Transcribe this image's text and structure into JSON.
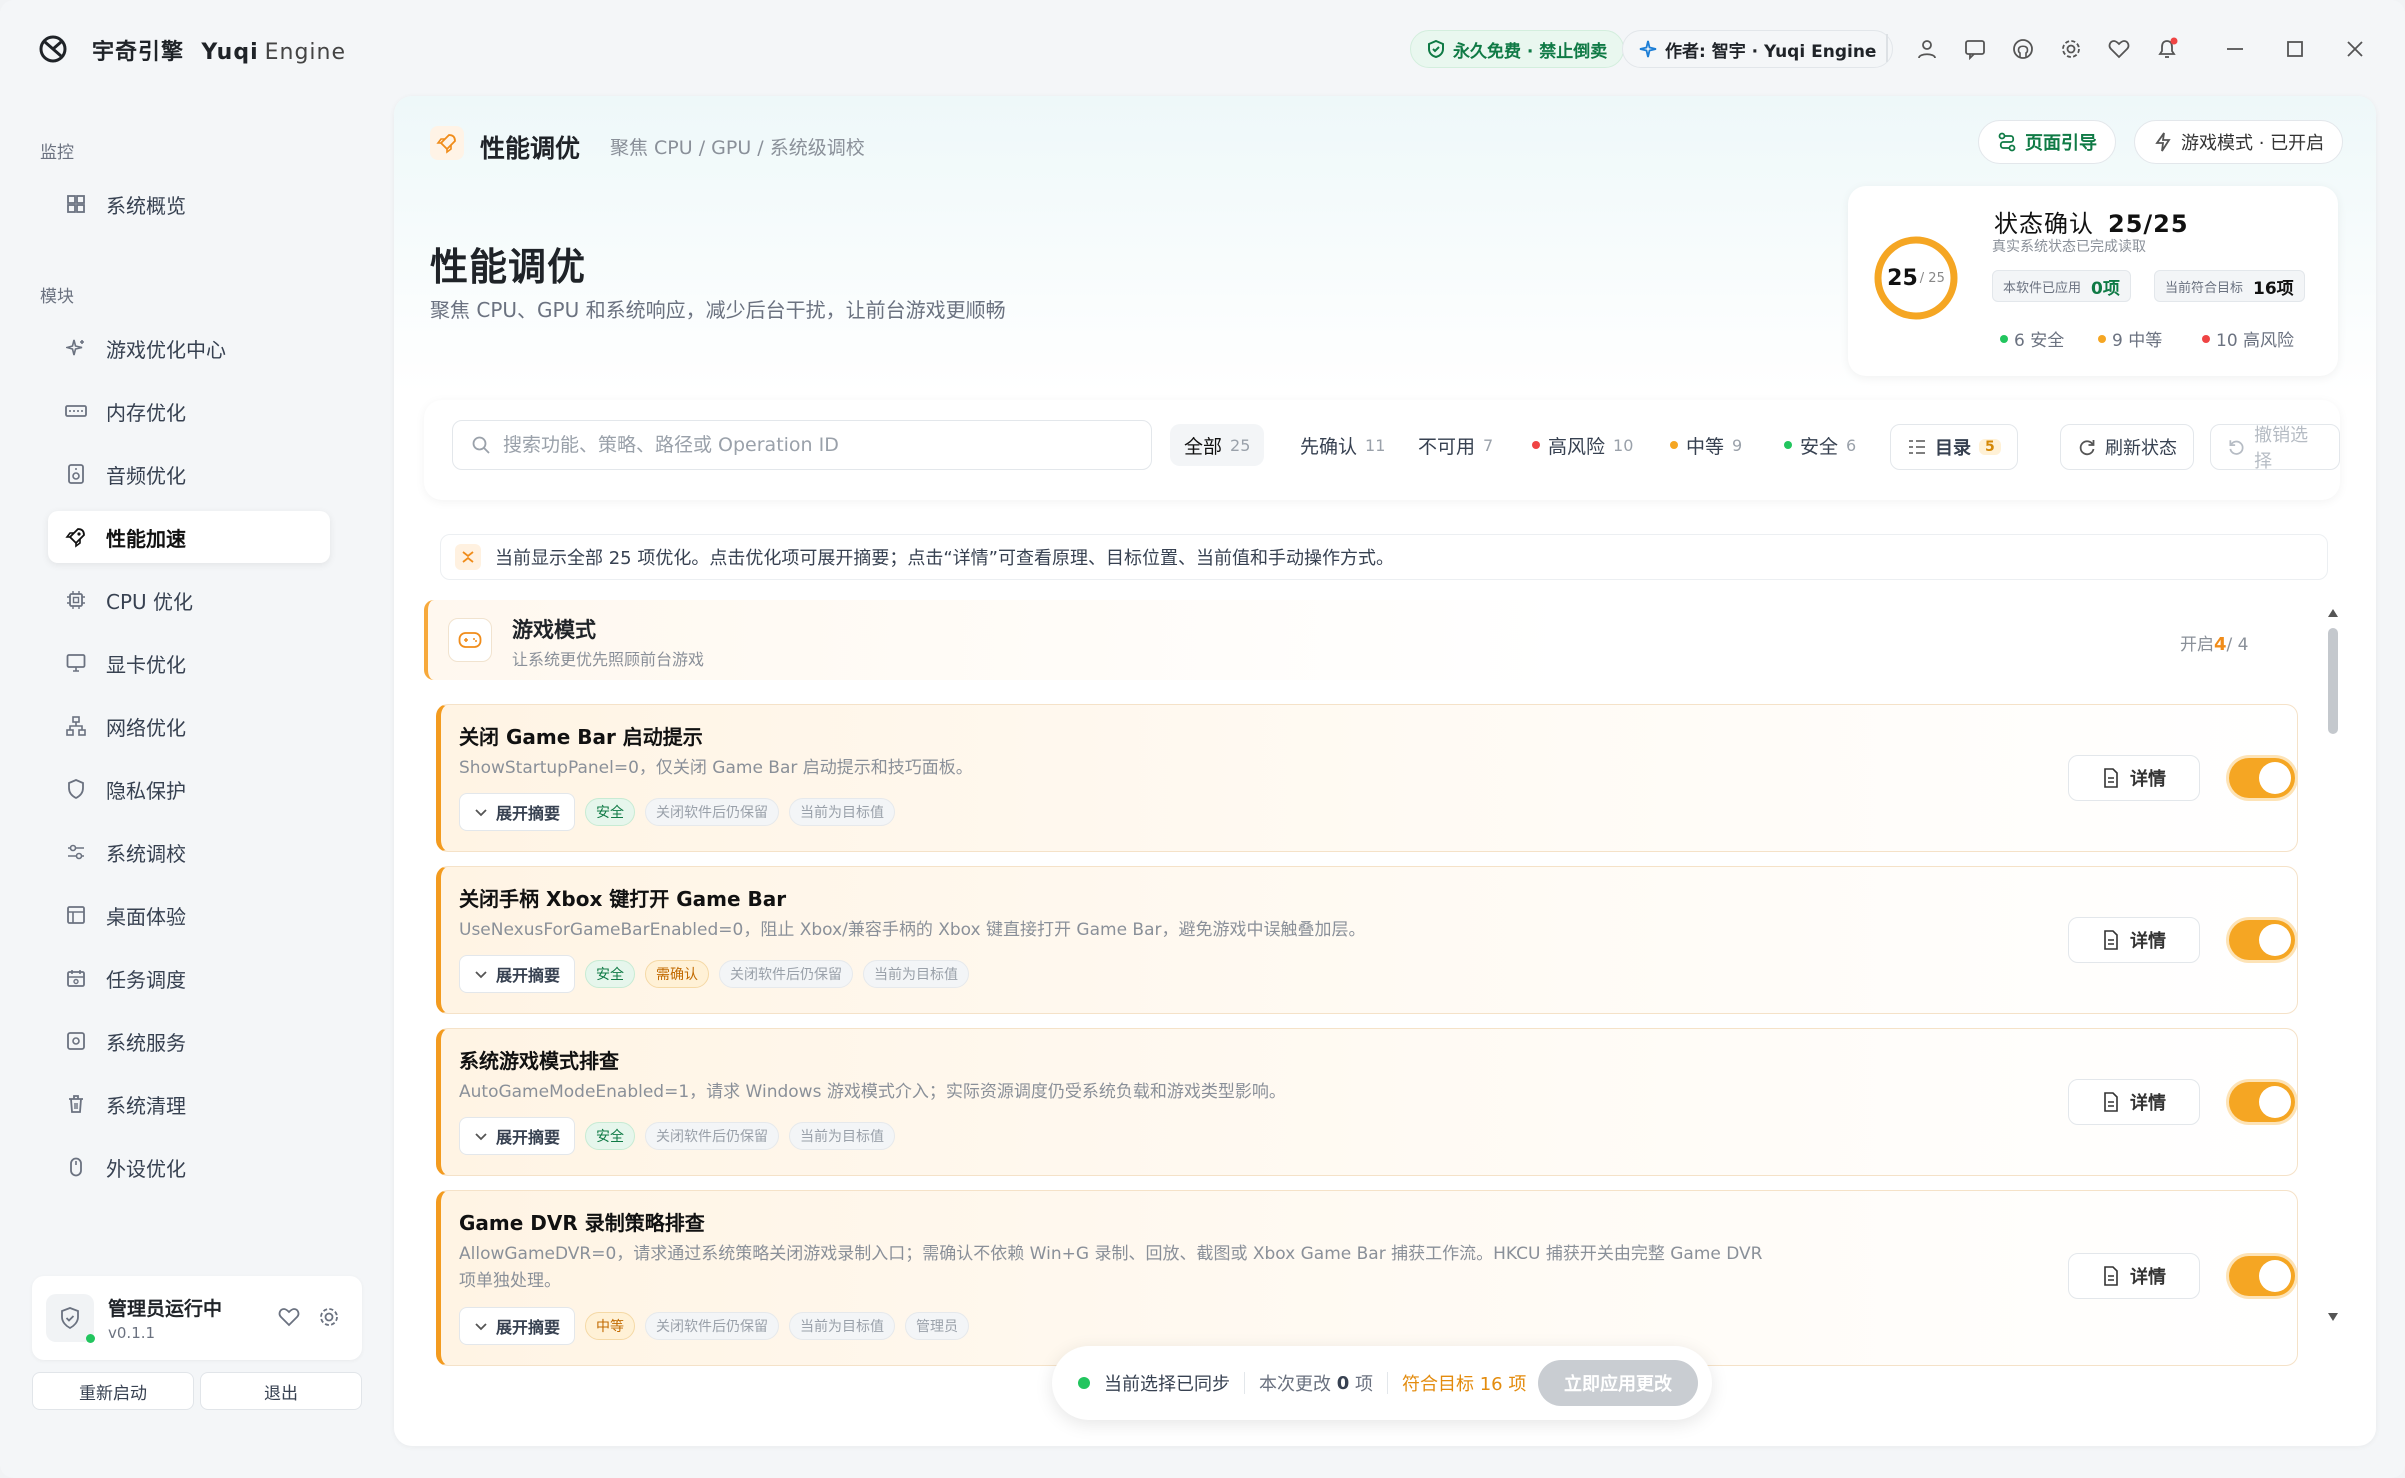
{
  "app": {
    "name": "宇奇引擎",
    "name_en": "Yuqi",
    "name_sub": "Engine"
  },
  "titlebar": {
    "free_label": "永久免费 · 禁止倒卖",
    "author_label": "作者: 智宇 · Yuqi Engine",
    "icons": [
      "user-icon",
      "message-icon",
      "github-icon",
      "gear-icon",
      "heart-icon",
      "bell-icon",
      "minimize-icon",
      "maximize-icon",
      "close-icon"
    ]
  },
  "sidebar": {
    "section_monitor": "监控",
    "section_modules": "模块",
    "overview": "系统概览",
    "items": [
      {
        "label": "游戏优化中心",
        "icon": "sparkle-icon"
      },
      {
        "label": "内存优化",
        "icon": "memory-icon"
      },
      {
        "label": "音频优化",
        "icon": "speaker-icon"
      },
      {
        "label": "性能加速",
        "icon": "rocket-icon",
        "active": true
      },
      {
        "label": "CPU 优化",
        "icon": "cpu-icon"
      },
      {
        "label": "显卡优化",
        "icon": "monitor-icon"
      },
      {
        "label": "网络优化",
        "icon": "network-icon"
      },
      {
        "label": "隐私保护",
        "icon": "shield-icon"
      },
      {
        "label": "系统调校",
        "icon": "sliders-icon"
      },
      {
        "label": "桌面体验",
        "icon": "layout-icon"
      },
      {
        "label": "任务调度",
        "icon": "calendar-icon"
      },
      {
        "label": "系统服务",
        "icon": "service-icon"
      },
      {
        "label": "系统清理",
        "icon": "trash-icon"
      },
      {
        "label": "外设优化",
        "icon": "mouse-icon"
      }
    ],
    "admin": {
      "title": "管理员运行中",
      "version": "v0.1.1"
    },
    "restart_label": "重新启动",
    "exit_label": "退出"
  },
  "header": {
    "title": "性能调优",
    "subtitle": "聚焦 CPU / GPU / 系统级调校",
    "guide_label": "页面引导",
    "game_mode_label": "游戏模式 · 已开启",
    "h1": "性能调优",
    "h1_sub": "聚焦 CPU、GPU 和系统响应，减少后台干扰，让前台游戏更顺畅"
  },
  "status": {
    "ring_value": "25",
    "ring_total": "/ 25",
    "ring_fraction": 1.0,
    "title": "状态确认",
    "title_value": "25/25",
    "sub": "真实系统状态已完成读取",
    "applied_label": "本软件已应用",
    "applied_value": "0项",
    "match_label": "当前符合目标",
    "match_value": "16项",
    "safe": "6 安全",
    "mid": "9 中等",
    "high": "10 高风险",
    "colors": {
      "safe": "#22c55e",
      "mid": "#f5a623",
      "high": "#ef4444"
    }
  },
  "filters": {
    "search_placeholder": "搜索功能、策略、路径或 Operation ID",
    "tabs": [
      {
        "label": "全部",
        "count": "25"
      },
      {
        "label": "先确认",
        "count": "11"
      },
      {
        "label": "不可用",
        "count": "7"
      },
      {
        "label": "高风险",
        "count": "10"
      },
      {
        "label": "中等",
        "count": "9"
      },
      {
        "label": "安全",
        "count": "6"
      }
    ],
    "toc_label": "目录",
    "toc_count": "5",
    "refresh_label": "刷新状态",
    "undo_label": "撤销选择"
  },
  "info": "当前显示全部 25 项优化。点击优化项可展开摘要；点击“详情”可查看原理、目标位置、当前值和手动操作方式。",
  "group": {
    "title": "游戏模式",
    "subtitle": "让系统更优先照顾前台游戏",
    "count_prefix": "开启",
    "count_on": "4",
    "count_total": "/ 4"
  },
  "items": [
    {
      "title": "关闭 Game Bar 启动提示",
      "desc": "ShowStartupPanel=0，仅关闭 Game Bar 启动提示和技巧面板。",
      "tags": [
        "安全",
        "关闭软件后仍保留",
        "当前为目标值"
      ]
    },
    {
      "title": "关闭手柄 Xbox 键打开 Game Bar",
      "desc": "UseNexusForGameBarEnabled=0，阻止 Xbox/兼容手柄的 Xbox 键直接打开 Game Bar，避免游戏中误触叠加层。",
      "tags": [
        "安全",
        "需确认",
        "关闭软件后仍保留",
        "当前为目标值"
      ]
    },
    {
      "title": "系统游戏模式排查",
      "desc": "AutoGameModeEnabled=1，请求 Windows 游戏模式介入；实际资源调度仍受系统负载和游戏类型影响。",
      "tags": [
        "安全",
        "关闭软件后仍保留",
        "当前为目标值"
      ]
    },
    {
      "title": "Game DVR 录制策略排查",
      "desc": "AllowGameDVR=0，请求通过系统策略关闭游戏录制入口；需确认不依赖 Win+G 录制、回放、截图或 Xbox Game Bar 捕获工作流。HKCU 捕获开关由完整 Game DVR 项单独处理。",
      "tags": [
        "中等",
        "关闭软件后仍保留",
        "当前为目标值",
        "管理员"
      ]
    }
  ],
  "common": {
    "expand_label": "展开摘要",
    "detail_label": "详情"
  },
  "bottom": {
    "synced": "当前选择已同步",
    "changes_label": "本次更改",
    "changes_value": "0",
    "changes_unit": "项",
    "target": "符合目标 16 项",
    "apply": "立即应用更改"
  },
  "accent": "#f5a623",
  "brand_green": "#0f7a45"
}
